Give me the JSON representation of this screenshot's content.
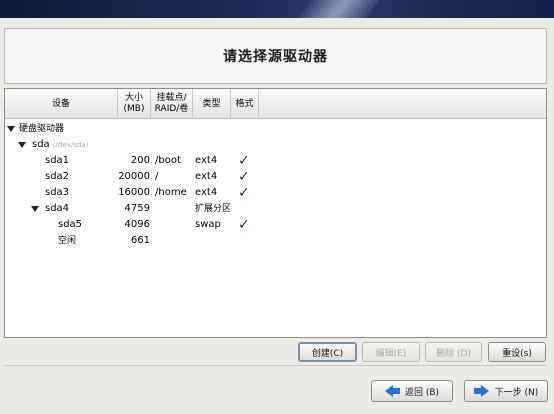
{
  "title": "请选择源驱动器",
  "columns": {
    "device": "设备",
    "size": "大小\n(MB)",
    "mount": "挂载点/\nRAID/卷",
    "type": "类型",
    "format": "格式"
  },
  "tree": {
    "root_label": "硬盘驱动器",
    "disk_name": "sda",
    "disk_path": "(/dev/sda)",
    "rows": [
      {
        "device": "sda1",
        "size": "200",
        "mount": "/boot",
        "type": "ext4",
        "format": "✓"
      },
      {
        "device": "sda2",
        "size": "20000",
        "mount": "/",
        "type": "ext4",
        "format": "✓"
      },
      {
        "device": "sda3",
        "size": "16000",
        "mount": "/home",
        "type": "ext4",
        "format": "✓"
      },
      {
        "device": "sda4",
        "size": "4759",
        "mount": "",
        "type": "扩展分区",
        "format": ""
      },
      {
        "device": "sda5",
        "size": "4096",
        "mount": "",
        "type": "swap",
        "format": "✓"
      },
      {
        "device": "空闲",
        "size": "661",
        "mount": "",
        "type": "",
        "format": ""
      }
    ]
  },
  "actions": {
    "create": "创建(C)",
    "edit": "编辑(E)",
    "delete": "删除 (D)",
    "reset": "重设(s)"
  },
  "nav": {
    "back": "返回 (B)",
    "next": "下一步 (N)"
  },
  "colors": {
    "check": "#1c2a63",
    "arrow": "#2b6fd6"
  }
}
